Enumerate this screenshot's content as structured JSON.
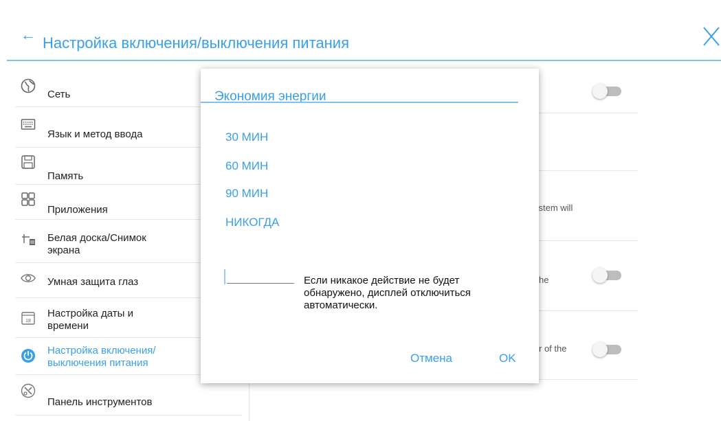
{
  "header": {
    "title": "Настройка включения/выключения питания"
  },
  "sidebar": {
    "items": [
      {
        "label": "Сеть",
        "icon": "globe-icon"
      },
      {
        "label": "Язык и метод ввода",
        "icon": "keyboard-icon"
      },
      {
        "label": "Память",
        "icon": "storage-icon"
      },
      {
        "label": "Приложения",
        "icon": "apps-grid-icon"
      },
      {
        "label_line1": "Белая доска/Снимок",
        "label_line2": "экрана",
        "icon": "whiteboard-screenshot-icon"
      },
      {
        "label": "Умная защита глаз",
        "icon": "eye-icon"
      },
      {
        "label_line1": "Настройка даты и",
        "label_line2": "времени",
        "icon": "calendar-icon",
        "calendar_day": "18"
      },
      {
        "label_line1": "Настройка включения/",
        "label_line2": "выключения питания",
        "icon": "power-settings-icon",
        "active": true
      },
      {
        "label": "Панель инструментов",
        "icon": "toolbar-icon"
      }
    ]
  },
  "background": {
    "text1": "ystem will",
    "text2": "he",
    "text3": "r of the"
  },
  "dialog": {
    "title": "Экономия энергии",
    "options": [
      "30 МИН",
      "60 МИН",
      "90 МИН",
      "НИКОГДА"
    ],
    "tooltip_line1": "Если никакое действие не будет",
    "tooltip_line2": "обнаружено, дисплей отключиться",
    "tooltip_line3": "автоматически.",
    "cancel_label": "Отмена",
    "ok_label": "OK"
  },
  "colors": {
    "accent": "#3aa0e6",
    "accent_light": "#7fc2f0"
  }
}
